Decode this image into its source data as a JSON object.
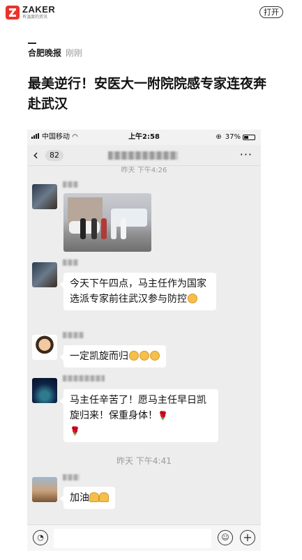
{
  "header": {
    "logo_name": "ZAKER",
    "logo_slogan": "有温度的资讯",
    "open_button": "打开"
  },
  "article": {
    "source": "合肥晚报",
    "time": "刚刚",
    "title": "最美逆行！安医大一附院院感专家连夜奔赴武汉"
  },
  "screenshot": {
    "status": {
      "carrier": "中国移动",
      "time": "上午2:58",
      "battery": "37%"
    },
    "nav": {
      "back_count": "82",
      "more": "···"
    },
    "timestamp_top": "昨天 下午4:26",
    "messages": [
      {
        "text": "今天下午四点，马主任作为国家选派专家前往武汉参与防控"
      },
      {
        "text": "一定凯旋而归"
      },
      {
        "text": "马主任辛苦了！愿马主任早日凯旋归来！保重身体！"
      },
      {
        "text": "加油"
      }
    ],
    "timestamp_mid": "昨天 下午4:41",
    "colors": {
      "chat_bg": "#ededed",
      "bubble_bg": "#ffffff",
      "brand_red": "#e8332c"
    }
  }
}
